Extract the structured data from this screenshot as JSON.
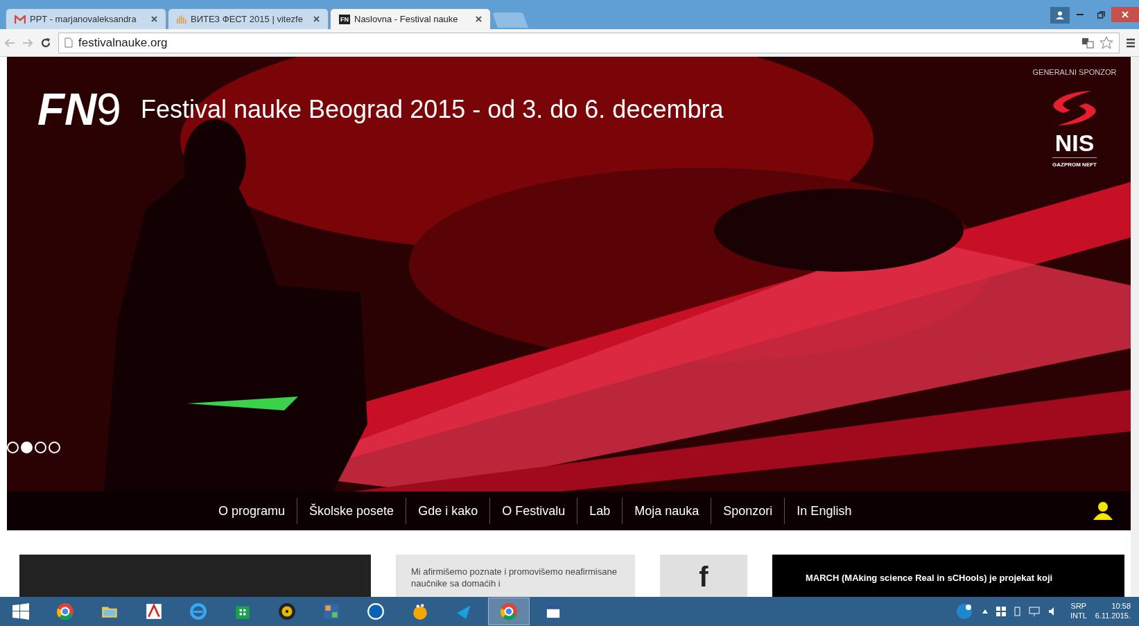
{
  "browser": {
    "tabs": [
      {
        "title": "PPT - marjanovaleksandra",
        "kind": "mail",
        "selected": false
      },
      {
        "title": "ВИТЕЗ ФЕСТ 2015 | vitezfe",
        "kind": "bars",
        "selected": false
      },
      {
        "title": "Naslovna - Festival nauke",
        "kind": "fn",
        "selected": true
      }
    ],
    "favicon_text": "FN",
    "url": "festivalnauke.org"
  },
  "hero": {
    "logo_letters": "FN",
    "logo_digit": "9",
    "title": "Festival nauke Beograd 2015 - od 3. do 6. decembra",
    "sponsor": {
      "label": "GENERALNI SPONZOR",
      "brand": "NIS",
      "sub": "GAZPROM NEFT"
    },
    "dots": [
      {
        "selected": false
      },
      {
        "selected": true
      },
      {
        "selected": false
      },
      {
        "selected": false
      }
    ]
  },
  "nav": {
    "items": [
      "O programu",
      "Školske posete",
      "Gde i kako",
      "O Festivalu",
      "Lab",
      "Moja nauka",
      "Sponzori",
      "In English"
    ]
  },
  "cards": [
    {
      "kind": "dark"
    },
    {
      "kind": "text",
      "text": "Mi afirmišemo poznate i promovišemo neafirmisane naučnike sa domaćih i"
    },
    {
      "kind": "social",
      "glyph": "f"
    },
    {
      "kind": "black",
      "text": "MARCH (MAking science Real in sCHools) je projekat koji"
    }
  ],
  "taskbar": {
    "apps": [
      {
        "kind": "chrome",
        "selected": false
      },
      {
        "kind": "folder",
        "selected": false
      },
      {
        "kind": "pdf",
        "selected": false
      },
      {
        "kind": "ie",
        "selected": false
      },
      {
        "kind": "store",
        "selected": false
      },
      {
        "kind": "disc",
        "selected": false
      },
      {
        "kind": "puzzle",
        "selected": false
      },
      {
        "kind": "hp",
        "selected": false
      },
      {
        "kind": "bulb",
        "selected": false
      },
      {
        "kind": "wave",
        "selected": false
      },
      {
        "kind": "chrome",
        "selected": true
      },
      {
        "kind": "word",
        "selected": false
      }
    ],
    "language": "SRP",
    "layout": "INTL",
    "time": "10:58",
    "date": "6.11.2015."
  }
}
